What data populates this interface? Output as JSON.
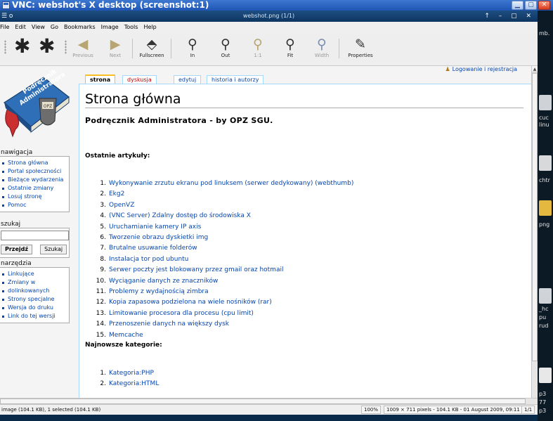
{
  "vnc": {
    "title": "VNC: webshot's X desktop (screenshot:1)"
  },
  "viewer": {
    "title": "webshot.png (1/1)",
    "controls": "↑ – ▢ ✕"
  },
  "menu": [
    "File",
    "Edit",
    "View",
    "Go",
    "Bookmarks",
    "Image",
    "Tools",
    "Help"
  ],
  "toolbar": {
    "previous": "Previous",
    "next": "Next",
    "fullscreen": "Fullscreen",
    "zoom_in": "In",
    "zoom_out": "Out",
    "one_to_one": "1:1",
    "fit": "Fit",
    "width": "Width",
    "properties": "Properties"
  },
  "logo": {
    "line1": "Podręcznik",
    "line2": "Administratora",
    "badge": "OPZ"
  },
  "navigation": {
    "heading": "nawigacja",
    "items": [
      "Strona główna",
      "Portal społeczności",
      "Bieżące wydarzenia",
      "Ostatnie zmiany",
      "Losuj stronę",
      "Pomoc"
    ]
  },
  "search": {
    "heading": "szukaj",
    "go": "Przejdź",
    "search": "Szukaj"
  },
  "tools": {
    "heading": "narzędzia",
    "items": [
      "Linkujące",
      "Zmiany w",
      "dolinkowanych",
      "Strony specjalne",
      "Wersja do druku",
      "Link do tej wersji"
    ]
  },
  "tabs": [
    "strona",
    "dyskusja",
    "edytuj",
    "historia i autorzy"
  ],
  "login": "Logowanie i rejestracja",
  "article": {
    "title": "Strona główna",
    "subtitle": "Podręcznik Administratora - by OPZ SGU.",
    "recent_heading": "Ostatnie artykuły:",
    "recent": [
      {
        "n": "1.",
        "t": "Wykonywanie zrzutu ekranu pod linuksem (serwer dedykowany) (webthumb)"
      },
      {
        "n": "2.",
        "t": "Ekg2"
      },
      {
        "n": "3.",
        "t": "OpenVZ"
      },
      {
        "n": "4.",
        "t": "(VNC Server) Zdalny dostęp do środowiska X"
      },
      {
        "n": "5.",
        "t": "Uruchamianie kamery IP axis"
      },
      {
        "n": "6.",
        "t": "Tworzenie obrazu dyskietki img"
      },
      {
        "n": "7.",
        "t": "Brutalne usuwanie folderów"
      },
      {
        "n": "8.",
        "t": "Instalacja tor pod ubuntu"
      },
      {
        "n": "9.",
        "t": "Serwer poczty jest blokowany przez gmail oraz hotmail"
      },
      {
        "n": "10.",
        "t": "Wyciąganie danych ze znaczników"
      },
      {
        "n": "11.",
        "t": "Problemy z wydajnością zimbra"
      },
      {
        "n": "12.",
        "t": "Kopia zapasowa podzielona na wiele nośników (rar)"
      },
      {
        "n": "13.",
        "t": "Limitowanie procesora dla procesu (cpu limit)"
      },
      {
        "n": "14.",
        "t": "Przenoszenie danych na większy dysk"
      },
      {
        "n": "15.",
        "t": "Memcache"
      }
    ],
    "categories_heading": "Najnowsze kategorie:",
    "categories": [
      {
        "n": "1.",
        "t": "Kategoria:PHP"
      },
      {
        "n": "2.",
        "t": "Kategoria:HTML"
      }
    ]
  },
  "status": {
    "left": "image (104.1 KB), 1 selected (104.1 KB)",
    "zoom": "100%",
    "info": "1009 × 711 pixels - 104.1 KB - 01 August 2009, 09:11",
    "page": "1/1"
  },
  "desktop": [
    "mb.",
    "cuc",
    "linu",
    "chtr",
    "png",
    "_hc",
    "pu",
    "rud",
    "p3",
    "77",
    "p3"
  ],
  "colors": {
    "link": "#0645ad",
    "vnc_title": "#2b62c4",
    "viewer_title": "#133f6e"
  }
}
